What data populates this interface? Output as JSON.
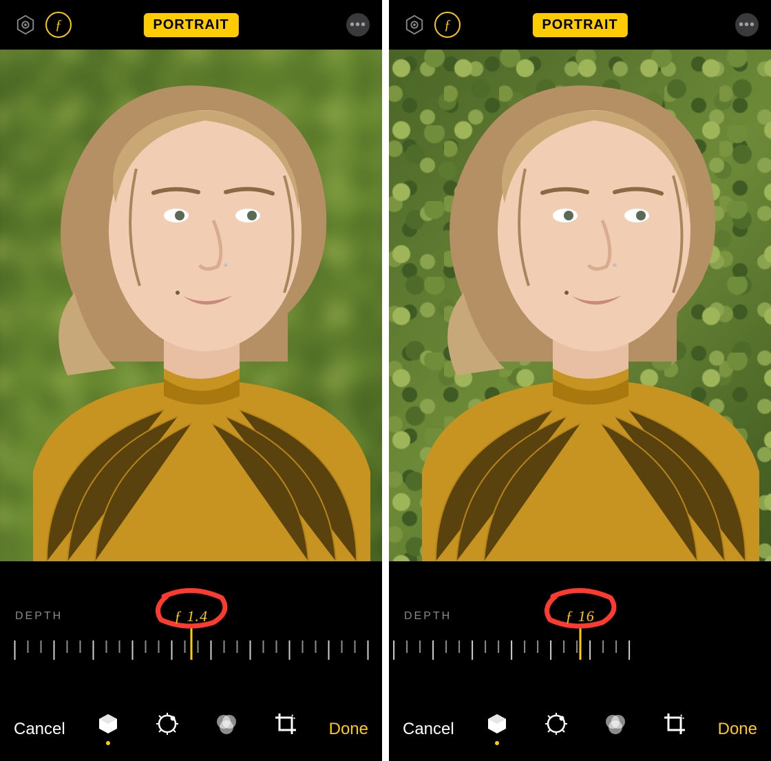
{
  "panes": [
    {
      "mode_badge": "PORTRAIT",
      "depth_label": "DEPTH",
      "depth_value": "ƒ 1.4",
      "background_blurred": true,
      "cancel_label": "Cancel",
      "done_label": "Done"
    },
    {
      "mode_badge": "PORTRAIT",
      "depth_label": "DEPTH",
      "depth_value": "ƒ 16",
      "background_blurred": false,
      "cancel_label": "Cancel",
      "done_label": "Done"
    }
  ],
  "icons": {
    "aperture": "ƒ",
    "more": "•••"
  },
  "colors": {
    "accent": "#ffcc00",
    "annotation": "#ff3b30"
  }
}
